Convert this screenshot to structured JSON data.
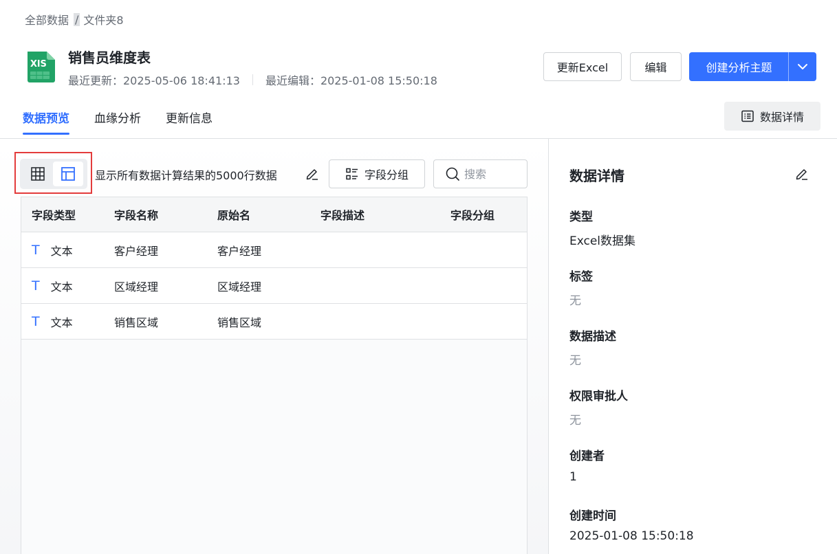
{
  "breadcrumb": {
    "root": "全部数据",
    "separator": "/",
    "current": "文件夹8"
  },
  "header": {
    "file_icon_label": "XlS",
    "title": "销售员维度表",
    "last_update": "最近更新：2025-05-06 18:41:13",
    "last_edit": "最近编辑：2025-01-08 15:50:18"
  },
  "actions": {
    "update_excel": "更新Excel",
    "edit": "编辑",
    "create_topic": "创建分析主题"
  },
  "tabs": [
    {
      "label": "数据预览",
      "active": true
    },
    {
      "label": "血缘分析",
      "active": false
    },
    {
      "label": "更新信息",
      "active": false
    }
  ],
  "detail_button": "数据详情",
  "toolbar": {
    "rows_text": "显示所有数据计算结果的5000行数据",
    "group_button": "字段分组",
    "search_placeholder": "搜索"
  },
  "table": {
    "headers": [
      "字段类型",
      "字段名称",
      "原始名",
      "字段描述",
      "字段分组"
    ],
    "rows": [
      {
        "type_icon": "T",
        "type": "文本",
        "name": "客户经理",
        "original": "客户经理",
        "desc": "",
        "group": ""
      },
      {
        "type_icon": "T",
        "type": "文本",
        "name": "区域经理",
        "original": "区域经理",
        "desc": "",
        "group": ""
      },
      {
        "type_icon": "T",
        "type": "文本",
        "name": "销售区域",
        "original": "销售区域",
        "desc": "",
        "group": ""
      }
    ]
  },
  "details": {
    "title": "数据详情",
    "fields": [
      {
        "label": "类型",
        "value": "Excel数据集"
      },
      {
        "label": "标签",
        "value": "无"
      },
      {
        "label": "数据描述",
        "value": "无"
      },
      {
        "label": "权限审批人",
        "value": "无"
      },
      {
        "label": "创建者",
        "value": "1"
      },
      {
        "label": "创建时间",
        "value": "2025-01-08 15:50:18"
      }
    ]
  },
  "colors": {
    "accent": "#3370ff",
    "excel_green": "#21a366",
    "highlight": "#e33b3b"
  }
}
